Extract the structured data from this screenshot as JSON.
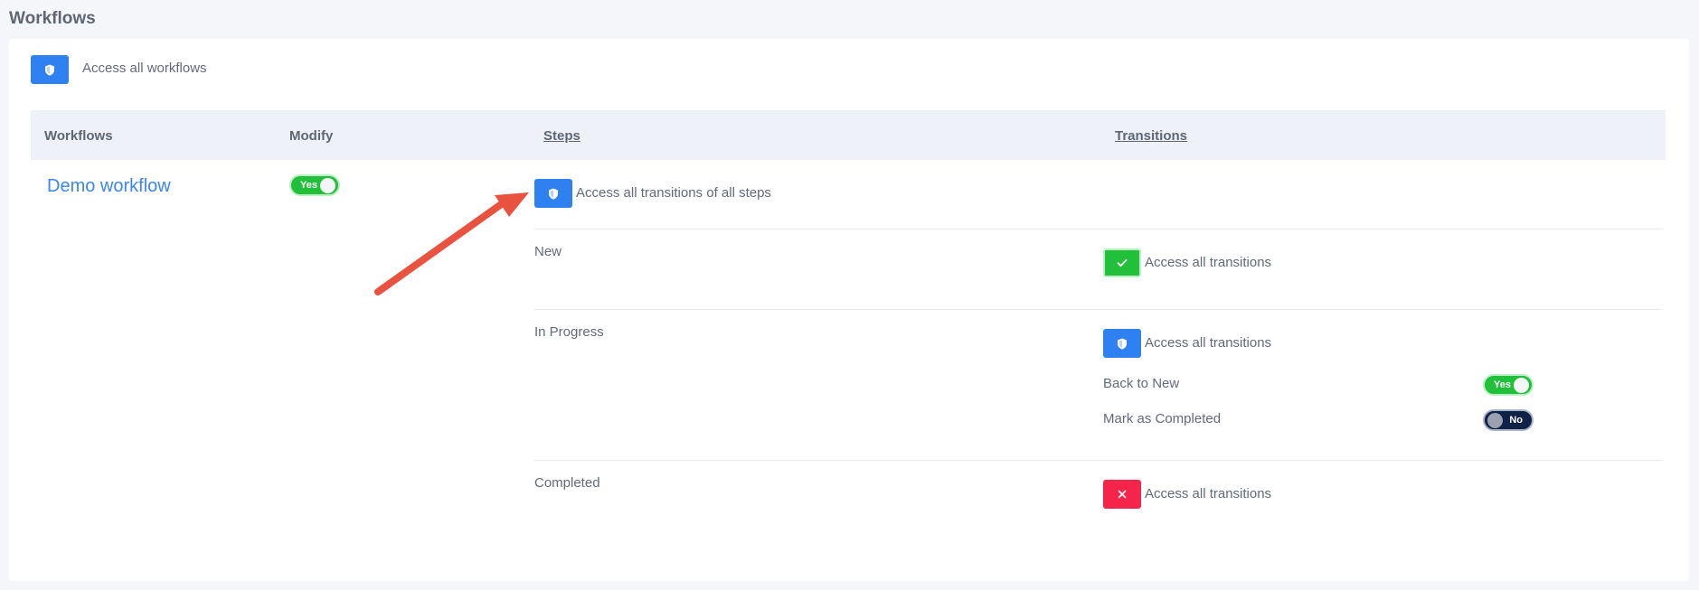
{
  "page": {
    "title": "Workflows"
  },
  "access_all_workflows": {
    "label": "Access all workflows",
    "icon": "shield-icon",
    "color": "#2f80f0"
  },
  "table": {
    "headers": {
      "workflows": "Workflows",
      "modify": "Modify",
      "steps": "Steps",
      "transitions": "Transitions"
    }
  },
  "workflow": {
    "name": "Demo workflow",
    "modify_toggle": "Yes",
    "access_all_steps_label": "Access all transitions of all steps",
    "steps": [
      {
        "name": "New",
        "access_label": "Access all transitions",
        "access_state": "granted",
        "access_icon": "check-icon",
        "access_color": "#21bf3a"
      },
      {
        "name": "In Progress",
        "access_label": "Access all transitions",
        "access_state": "partial",
        "access_icon": "shield-icon",
        "access_color": "#2f80f0",
        "transitions": [
          {
            "name": "Back to New",
            "toggle": "Yes"
          },
          {
            "name": "Mark as Completed",
            "toggle": "No"
          }
        ]
      },
      {
        "name": "Completed",
        "access_label": "Access all transitions",
        "access_state": "denied",
        "access_icon": "x-icon",
        "access_color": "#f5244b"
      }
    ]
  },
  "annotation": {
    "type": "arrow",
    "color": "#e8523f"
  }
}
